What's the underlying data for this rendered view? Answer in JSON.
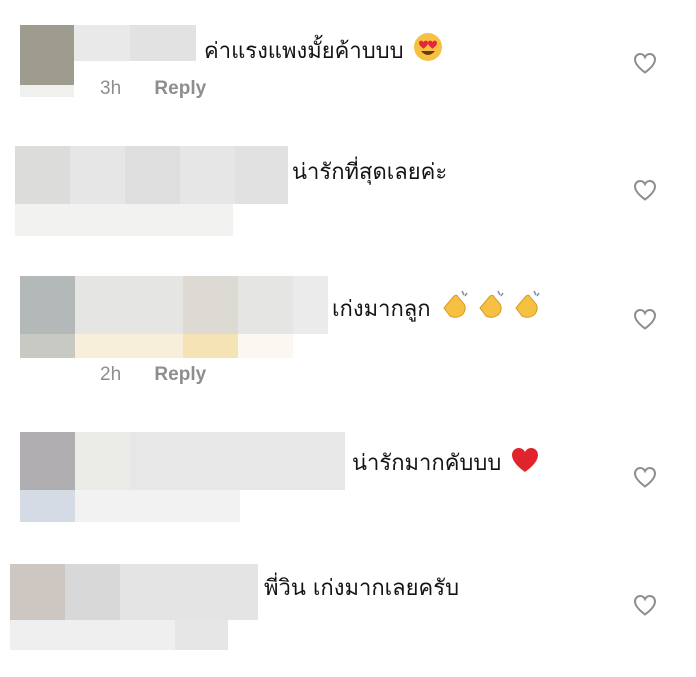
{
  "comments": [
    {
      "text": "ค่าแรงแพงมั้ยค้าบบบ",
      "emoji": "heart-eyes-emoji",
      "time": "3h",
      "reply": "Reply",
      "liked": false
    },
    {
      "text": "น่ารักที่สุดเลยค่ะ",
      "emoji": "",
      "time": "",
      "reply": "",
      "liked": false
    },
    {
      "text": "เก่งมากลูก",
      "emoji": "clapping-hands-emoji x3",
      "time": "2h",
      "reply": "Reply",
      "liked": false
    },
    {
      "text": "น่ารักมากคับบบ",
      "emoji": "red-heart-emoji",
      "time": "",
      "reply": "",
      "liked": false
    },
    {
      "text": "พี่วิน เก่งมากเลยครับ",
      "emoji": "",
      "time": "",
      "reply": "",
      "liked": false
    }
  ],
  "colors": {
    "heart_outline": "#8e8e8e",
    "meta_text": "#8e8e8e",
    "red_heart": "#e0242b",
    "emoji_yellow": "#f6c143"
  }
}
